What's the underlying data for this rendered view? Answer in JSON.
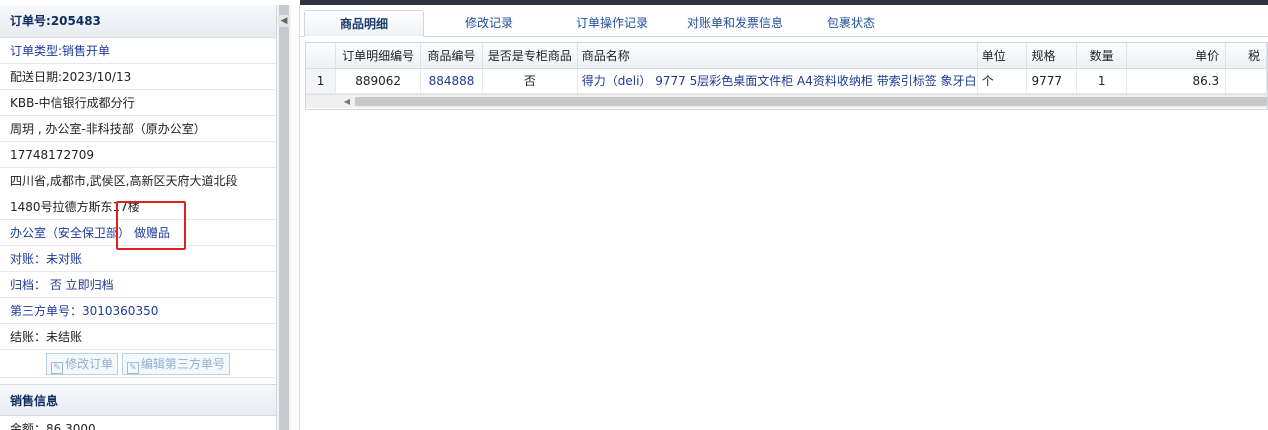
{
  "order": {
    "header_label": "订单号:",
    "number": "205483",
    "type_label": "订单类型:",
    "type_value": "销售开单",
    "delivery_date": "配送日期:2023/10/13",
    "customer": "KBB-中信银行成都分行",
    "contact": "周玥 , 办公室-非科技部（原办公室）",
    "phone": "17748172709",
    "address": "四川省,成都市,武侯区,高新区天府大道北段1480号拉德方斯东17楼",
    "department": "办公室（安全保卫部）",
    "gift_link": "做赠品",
    "reconcile": "对账：未对账",
    "archive": "归档：  否 立即归档",
    "third_party": "第三方单号：3010360350",
    "settlement": "结账：未结账",
    "edit_order_button": "修改订单",
    "edit_third_party_button": "编辑第三方单号"
  },
  "sales": {
    "header": "销售信息",
    "amount": "金额：86.3000"
  },
  "tabs": [
    {
      "label": "商品明细",
      "active": true
    },
    {
      "label": "修改记录"
    },
    {
      "label": "订单操作记录"
    },
    {
      "label": "对账单和发票信息"
    },
    {
      "label": "包裹状态"
    }
  ],
  "grid": {
    "columns": [
      "订单明细编号",
      "商品编号",
      "是否是专柜商品",
      "商品名称",
      "单位",
      "规格",
      "数量",
      "单价",
      "税"
    ],
    "rows": [
      {
        "index": "1",
        "detail_id": "889062",
        "product_id": "884888",
        "is_counter": "否",
        "name": "得力（deli） 9777 5层彩色桌面文件柜 A4资料收纳柜 带索引标签 象牙白",
        "unit": "个",
        "spec": "9777",
        "qty": "1",
        "price": "86.3",
        "tax": ""
      }
    ]
  },
  "colors": {
    "link": "#1f3a9a",
    "highlight_box": "#e02020",
    "header_text": "#0e2d5f"
  }
}
